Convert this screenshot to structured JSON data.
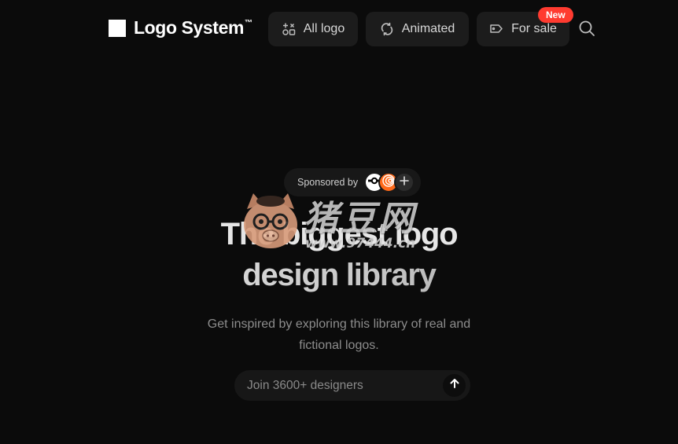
{
  "brand": {
    "name": "Logo System",
    "trademark": "™"
  },
  "nav": {
    "all_logo": {
      "label": "All logo",
      "icon": "shapes-icon"
    },
    "animated": {
      "label": "Animated",
      "icon": "refresh-icon"
    },
    "for_sale": {
      "label": "For sale",
      "icon": "tag-icon",
      "badge": "New"
    }
  },
  "search": {
    "icon": "search-icon"
  },
  "sponsor": {
    "label": "Sponsored by",
    "add_icon": "plus-icon"
  },
  "hero": {
    "title_line1": "The biggest logo",
    "title_line2": "design library",
    "subtitle": "Get inspired by exploring this library of real and fictional logos."
  },
  "cta": {
    "placeholder": "Join 3600+ designers",
    "submit_icon": "arrow-up-icon"
  },
  "watermark": {
    "chinese": "猪豆网",
    "url": "www.97444.cn"
  },
  "colors": {
    "background": "#0b0b0b",
    "button_bg": "#1c1c1c",
    "badge": "#ff3b30",
    "sponsor_orange": "#ff6a1a"
  }
}
